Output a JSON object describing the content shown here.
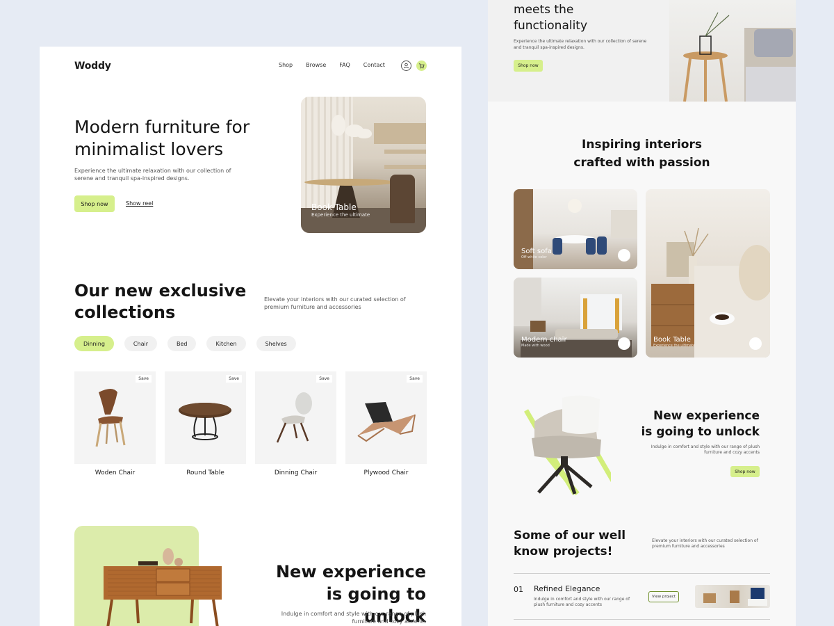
{
  "left": {
    "logo": "Woddy",
    "nav": [
      "Shop",
      "Browse",
      "FAQ",
      "Contact"
    ],
    "icons": [
      "user-icon",
      "cart-icon"
    ],
    "hero": {
      "title": "Modern furniture for minimalist lovers",
      "description": "Experience the ultimate relaxation with our collection of serene and tranquil spa-inspired designs.",
      "primary_button": "Shop now",
      "secondary_link": "Show reel",
      "card_title": "Book Table",
      "card_subtitle": "Experience the ultimate"
    },
    "collections": {
      "title": "Our  new exclusive collections",
      "description": "Elevate your interiors with our curated selection of premium furniture and accessories",
      "filters": [
        "Dinning",
        "Chair",
        "Bed",
        "Kitchen",
        "Shelves"
      ],
      "active_filter": "Dinning",
      "products": [
        {
          "name": "Woden Chair",
          "save": "Save"
        },
        {
          "name": "Round Table",
          "save": "Save"
        },
        {
          "name": "Dinning Chair",
          "save": "Save"
        },
        {
          "name": "Plywood Chair",
          "save": "Save"
        }
      ]
    },
    "experience": {
      "title": "New experience is going to unlock",
      "description": "Indulge in comfort and style with our range of plush furniture and cozy accents"
    }
  },
  "right": {
    "top": {
      "title_line1": "meets the",
      "title_line2": "functionality",
      "description": "Experience the ultimate relaxation with our collection of serene and tranquil spa-inspired designs.",
      "button": "Shop now"
    },
    "inspiring": {
      "title_line1": "Inspiring interiors",
      "title_line2": "crafted with passion",
      "rooms": [
        {
          "title": "Soft sofa",
          "subtitle": "Off-white color"
        },
        {
          "title": "Modern chair",
          "subtitle": "Made with wood"
        },
        {
          "title": "Book Table",
          "subtitle": "Experience the ultimate"
        }
      ]
    },
    "experience": {
      "title_line1": "New experience",
      "title_line2": "is going to unlock",
      "description": "Indulge in comfort and style with our range of plush furniture and cozy accents",
      "button": "Shop now"
    },
    "projects": {
      "title": "Some of our well know projects!",
      "description": "Elevate your interiors with our curated selection of premium furniture and accessories",
      "items": [
        {
          "number": "01",
          "name": "Refined Elegance",
          "description": "Indulge in comfort and style with our range of plush furniture and cozy accents",
          "button": "View project"
        }
      ]
    }
  },
  "colors": {
    "accent": "#d6ef8c",
    "background": "#e6ebf4",
    "text": "#141414",
    "card_green": "#dcecab"
  }
}
